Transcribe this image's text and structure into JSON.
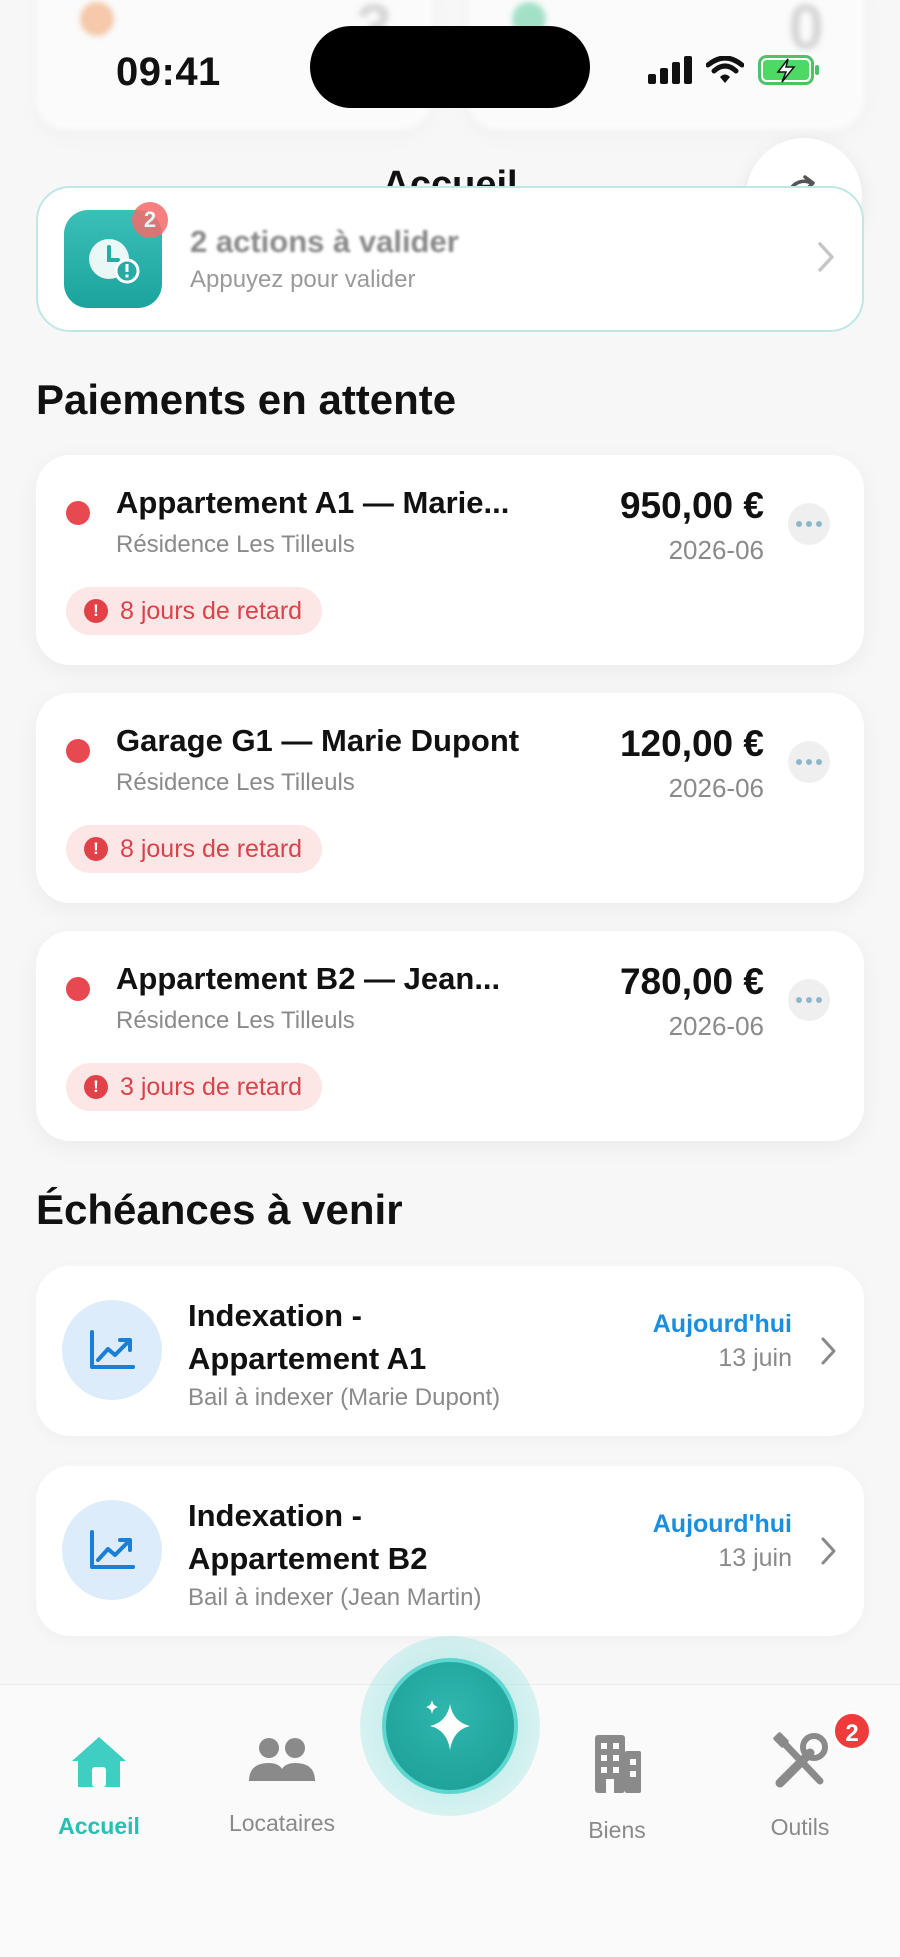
{
  "status_bar": {
    "time": "09:41"
  },
  "header": {
    "title": "Accueil"
  },
  "actions_banner": {
    "badge_count": "2",
    "title": "2 actions à valider",
    "subtitle": "Appuyez pour valider"
  },
  "pending_payments": {
    "title": "Paiements en attente",
    "items": [
      {
        "title": "Appartement A1 — Marie...",
        "subtitle": "Résidence Les Tilleuls",
        "amount": "950,00 €",
        "period": "2026-06",
        "late": "8 jours de retard"
      },
      {
        "title": "Garage G1 — Marie Dupont",
        "subtitle": "Résidence Les Tilleuls",
        "amount": "120,00 €",
        "period": "2026-06",
        "late": "8 jours de retard"
      },
      {
        "title": "Appartement B2 — Jean...",
        "subtitle": "Résidence Les Tilleuls",
        "amount": "780,00 €",
        "period": "2026-06",
        "late": "3 jours de retard"
      }
    ]
  },
  "upcoming": {
    "title": "Échéances à venir",
    "items": [
      {
        "title": "Indexation - Appartement A1",
        "subtitle": "Bail à indexer (Marie Dupont)",
        "when": "Aujourd'hui",
        "date": "13 juin"
      },
      {
        "title": "Indexation - Appartement B2",
        "subtitle": "Bail à indexer (Jean Martin)",
        "when": "Aujourd'hui",
        "date": "13 juin"
      }
    ]
  },
  "tab_bar": {
    "items": [
      {
        "label": "Accueil",
        "active": true
      },
      {
        "label": "Locataires"
      },
      {
        "label": "Biens"
      },
      {
        "label": "Outils",
        "badge": "2"
      }
    ]
  },
  "colors": {
    "accent": "#24c1b5",
    "danger": "#e14248",
    "link": "#1a8fe0"
  }
}
